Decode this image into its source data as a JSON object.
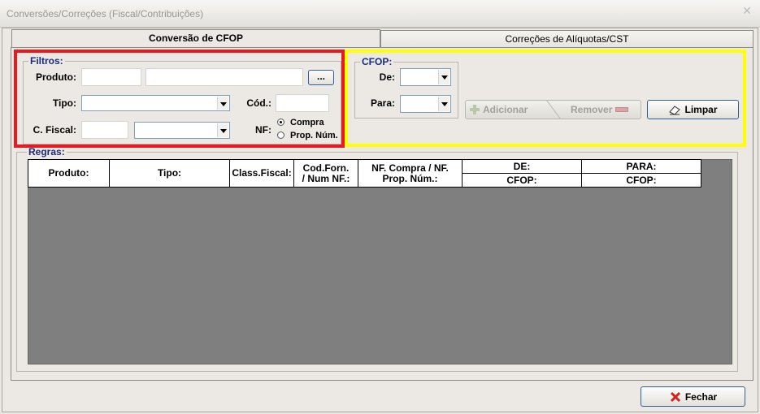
{
  "window": {
    "title": "Conversões/Correções (Fiscal/Contribuições)",
    "close_symbol": "✕"
  },
  "tabs": [
    {
      "label": "Conversão de CFOP",
      "active": true
    },
    {
      "label": "Correções de Alíquotas/CST",
      "active": false
    }
  ],
  "filtros": {
    "legend": "Filtros:",
    "produto_label": "Produto:",
    "produto_code_value": "",
    "produto_desc_value": "",
    "lookup_label": "...",
    "tipo_label": "Tipo:",
    "tipo_value": "",
    "cod_label": "Cód.:",
    "cod_value": "",
    "cfiscal_label": "C. Fiscal:",
    "cfiscal_value": "",
    "cfiscal_combo_value": "",
    "nf_label": "NF:",
    "nf_options": [
      {
        "label": "Compra",
        "checked": true
      },
      {
        "label": "Prop. Núm.",
        "checked": false
      }
    ]
  },
  "cfop": {
    "legend": "CFOP:",
    "de_label": "De:",
    "de_value": "",
    "para_label": "Para:",
    "para_value": ""
  },
  "actions": {
    "adicionar_label": "Adicionar",
    "remover_label": "Remover",
    "limpar_label": "Limpar",
    "fechar_label": "Fechar"
  },
  "regras": {
    "legend": "Regras:",
    "columns": [
      {
        "label": "Produto:"
      },
      {
        "label": "Tipo:"
      },
      {
        "label": "Class.Fiscal:"
      },
      {
        "label": "Cod.Forn. / Num NF.:"
      },
      {
        "label": "NF. Compra / NF. Prop. Núm.:"
      }
    ],
    "group_de": {
      "top": "DE:",
      "bottom": "CFOP:"
    },
    "group_para": {
      "top": "PARA:",
      "bottom": "CFOP:"
    },
    "rows": []
  },
  "colors": {
    "highlight_red": "#e8191f",
    "highlight_yellow": "#ffff00",
    "legend_blue": "#1a2a80",
    "grid_bg": "#7f7f7f"
  },
  "icons": {
    "adicionar": "plus-icon",
    "remover": "minus-icon",
    "limpar": "eraser-icon",
    "fechar": "red-x-icon"
  }
}
